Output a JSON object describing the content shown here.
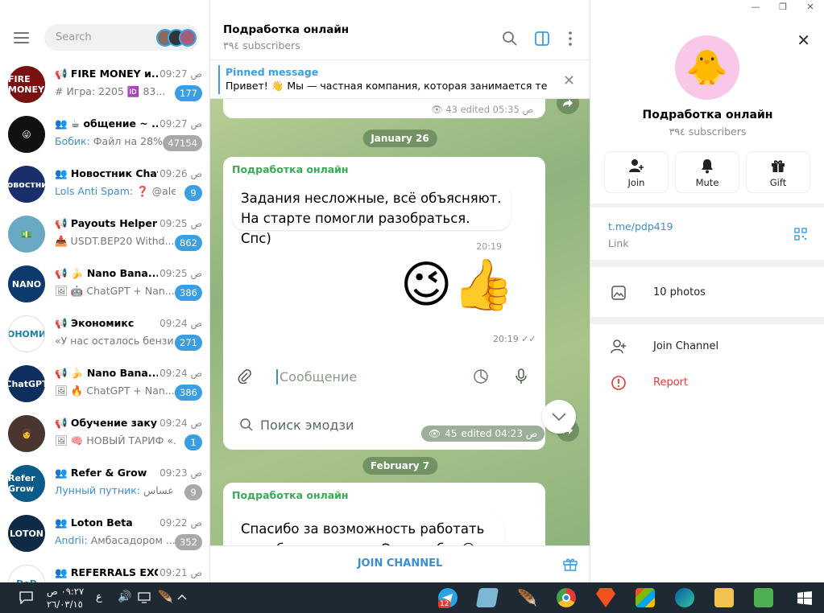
{
  "window": {
    "minimize": "—",
    "maximize": "❐",
    "close": "✕"
  },
  "sidebar": {
    "search_placeholder": "Search",
    "chats": [
      {
        "name": "FIRE MONEY и...",
        "time": "09:27 ص",
        "preview_prefix": "#",
        "preview": "Игра: 2205 🆔 83...",
        "badge": "177",
        "muted": false,
        "avatar_text": "FIRE MONEY",
        "avatar_color": "#7a1010",
        "type": "channel"
      },
      {
        "name": "☕ общение ~ ...",
        "time": "09:27 ص",
        "preview_sender": "Бобик:",
        "preview": "Файл на 28%...",
        "badge": "47154",
        "muted": true,
        "avatar_text": "😜",
        "avatar_color": "#111111",
        "type": "group"
      },
      {
        "name": "Новостник Chat",
        "time": "09:26 ص",
        "preview_sender": "Lols Anti Spam:",
        "preview": "❓ @ale...",
        "badge": "9",
        "muted": false,
        "avatar_text": "Новостник",
        "avatar_color": "#1a2e6b",
        "type": "group"
      },
      {
        "name": "Payouts Helper™",
        "time": "09:25 ص",
        "preview_prefix": "📥",
        "preview": "USDT.BEP20 Withd...",
        "badge": "862",
        "muted": false,
        "avatar_text": "💵",
        "avatar_color": "#6aa9c4",
        "type": "channel"
      },
      {
        "name": "🍌 Nano Bana...",
        "time": "09:25 ص",
        "preview_prefix": "🖼",
        "preview": "🤖 ChatGPT + Nan...",
        "badge": "386",
        "muted": false,
        "avatar_text": "NANO",
        "avatar_color": "#0d3a6e",
        "type": "channel"
      },
      {
        "name": "Экономикс",
        "time": "09:24 ص",
        "preview": "«У нас осталось бензи...",
        "badge": "271",
        "muted": false,
        "avatar_text": "ЭКОНОМИКС",
        "avatar_color": "#ffffff",
        "type": "channel"
      },
      {
        "name": "🍌 Nano Bana...",
        "time": "09:24 ص",
        "preview_prefix": "🖼",
        "preview": "🔥 ChatGPT + Nan...",
        "badge": "386",
        "muted": false,
        "avatar_text": "ChatGPT",
        "avatar_color": "#0d2e5e",
        "type": "channel"
      },
      {
        "name": "Обучение заку...",
        "time": "09:24 ص",
        "preview_prefix": "🖼",
        "preview": "🧠 НОВЫЙ ТАРИФ «...",
        "badge": "1",
        "muted": false,
        "avatar_text": "👩",
        "avatar_color": "#4a3530",
        "type": "channel"
      },
      {
        "name": "Refer & Grow",
        "time": "09:23 ص",
        "preview_sender": "Лунный путник:",
        "preview": "عساس ...",
        "badge": "9",
        "muted": true,
        "avatar_text": "Refer Grow",
        "avatar_color": "#0a5a8a",
        "type": "group"
      },
      {
        "name": "Loton Beta",
        "time": "09:22 ص",
        "preview_sender": "Andrii:",
        "preview": "Амбасадором ...",
        "badge": "352",
        "muted": true,
        "avatar_text": "LOTON",
        "avatar_color": "#0f2a45",
        "type": "group"
      },
      {
        "name": "REFERRALS EXC...",
        "time": "09:21 ص",
        "preview": "",
        "badge": "",
        "muted": false,
        "avatar_text": "DoD",
        "avatar_color": "#ffffff",
        "type": "group"
      }
    ]
  },
  "chat": {
    "title": "Подработка онлайн",
    "subscribers": "٣٩٤ subscribers",
    "pinned_title": "Pinned message",
    "pinned_text": "Привет! 👋 Мы — частная компания, которая занимается те...",
    "top_meta_views": "43",
    "top_meta_edited": "edited 05:35 ص",
    "date1": "January 26",
    "msg1_from": "Подработка онлайн",
    "msg1_text": "Задания несложные, всё объясняют. На старте помогли разобраться. Спс)",
    "msg1_time": "20:19",
    "msg1_emoji": "😉👍",
    "msg1_emoji_time": "20:19",
    "msg1_input_placeholder": "Сообщение",
    "msg1_emoji_search": "Поиск эмодзи",
    "msg1_views": "45",
    "msg1_edited": "edited 04:23 ص",
    "date2": "February 7",
    "msg2_from": "Подработка онлайн",
    "msg2_text": "Спасибо за возможность работать в свободное время. Это удобно😊",
    "join_label": "JOIN CHANNEL"
  },
  "profile": {
    "name": "Подработка онлайн",
    "subscribers": "٣٩٤ subscribers",
    "buttons": [
      {
        "label": "Join",
        "icon": "add-user-icon"
      },
      {
        "label": "Mute",
        "icon": "bell-icon"
      },
      {
        "label": "Gift",
        "icon": "gift-icon"
      }
    ],
    "link": "t.me/pdp419",
    "link_label": "Link",
    "photos": "10 photos",
    "join_channel": "Join Channel",
    "report": "Report",
    "report_color": "#e53935",
    "accent": "#3a9ee0"
  },
  "taskbar": {
    "time": "٠٩:٢٧ ص",
    "date": "٢٦/٠٣/١٥",
    "lang": "ع",
    "telegram_badge": "12"
  }
}
